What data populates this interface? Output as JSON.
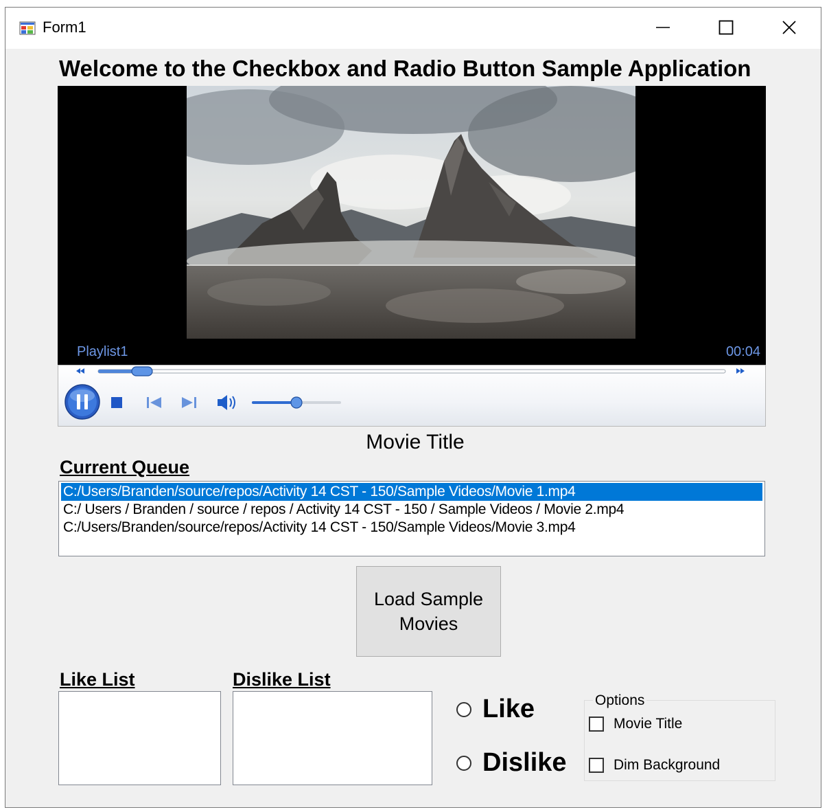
{
  "window": {
    "title": "Form1"
  },
  "heading": "Welcome to the Checkbox and Radio Button Sample Application",
  "player": {
    "playlist_label": "Playlist1",
    "time": "00:04",
    "seek_progress": 0.07,
    "volume_level": 0.5,
    "state": "playing"
  },
  "movie_title": "Movie Title",
  "queue": {
    "label": "Current Queue",
    "items": [
      {
        "text": "C:/Users/Branden/source/repos/Activity 14 CST - 150/Sample Videos/Movie 1.mp4",
        "selected": true
      },
      {
        "text": "C:/ Users / Branden / source / repos / Activity 14 CST - 150 / Sample Videos / Movie 2.mp4",
        "selected": false
      },
      {
        "text": "C:/Users/Branden/source/repos/Activity 14 CST - 150/Sample Videos/Movie 3.mp4",
        "selected": false
      }
    ]
  },
  "load_button": {
    "line1": "Load Sample",
    "line2": "Movies"
  },
  "like_list": {
    "label": "Like List",
    "items": []
  },
  "dislike_list": {
    "label": "Dislike List",
    "items": []
  },
  "rating": {
    "like_label": "Like",
    "dislike_label": "Dislike",
    "selected": null
  },
  "options": {
    "label": "Options",
    "movie_title_label": "Movie Title",
    "movie_title_checked": false,
    "dim_background_label": "Dim Background",
    "dim_background_checked": false
  },
  "colors": {
    "selection": "#0078d7",
    "player_text": "#6d97e6",
    "window_bg": "#f0f0f0"
  }
}
